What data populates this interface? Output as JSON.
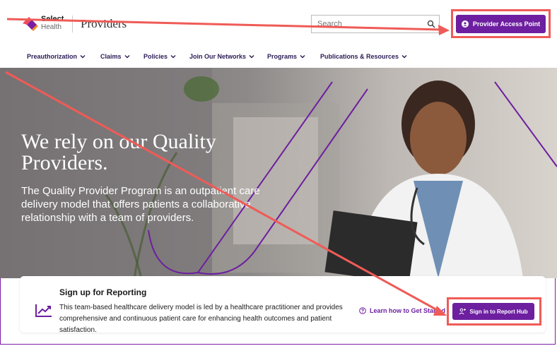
{
  "header": {
    "logo_name": "Select",
    "logo_sub": "Health",
    "site_title": "Providers",
    "search_placeholder": "Search",
    "provider_access_label": "Provider Access Point"
  },
  "nav": {
    "items": [
      {
        "label": "Preauthorization"
      },
      {
        "label": "Claims"
      },
      {
        "label": "Policies"
      },
      {
        "label": "Join Our Networks"
      },
      {
        "label": "Programs"
      },
      {
        "label": "Publications & Resources"
      }
    ]
  },
  "hero": {
    "title": "We rely on our Quality Providers.",
    "description": "The Quality Provider Program is an outpatient care delivery model that offers patients a collaborative relationship with a team of providers."
  },
  "reporting": {
    "title": "Sign up for Reporting",
    "description": "This team-based healthcare delivery model is led by a healthcare practitioner and provides comprehensive and continuous patient care for enhancing health outcomes and patient satisfaction.",
    "learn_link": "Learn how to Get Started",
    "button_label": "Sign in to Report Hub"
  },
  "colors": {
    "brand_purple": "#6d1fa0",
    "annotation_red": "#ef5b57"
  },
  "icons": [
    "search-icon",
    "user-icon",
    "chart-icon",
    "help-circle-icon",
    "user-plus-icon",
    "chevron-down-icon"
  ]
}
